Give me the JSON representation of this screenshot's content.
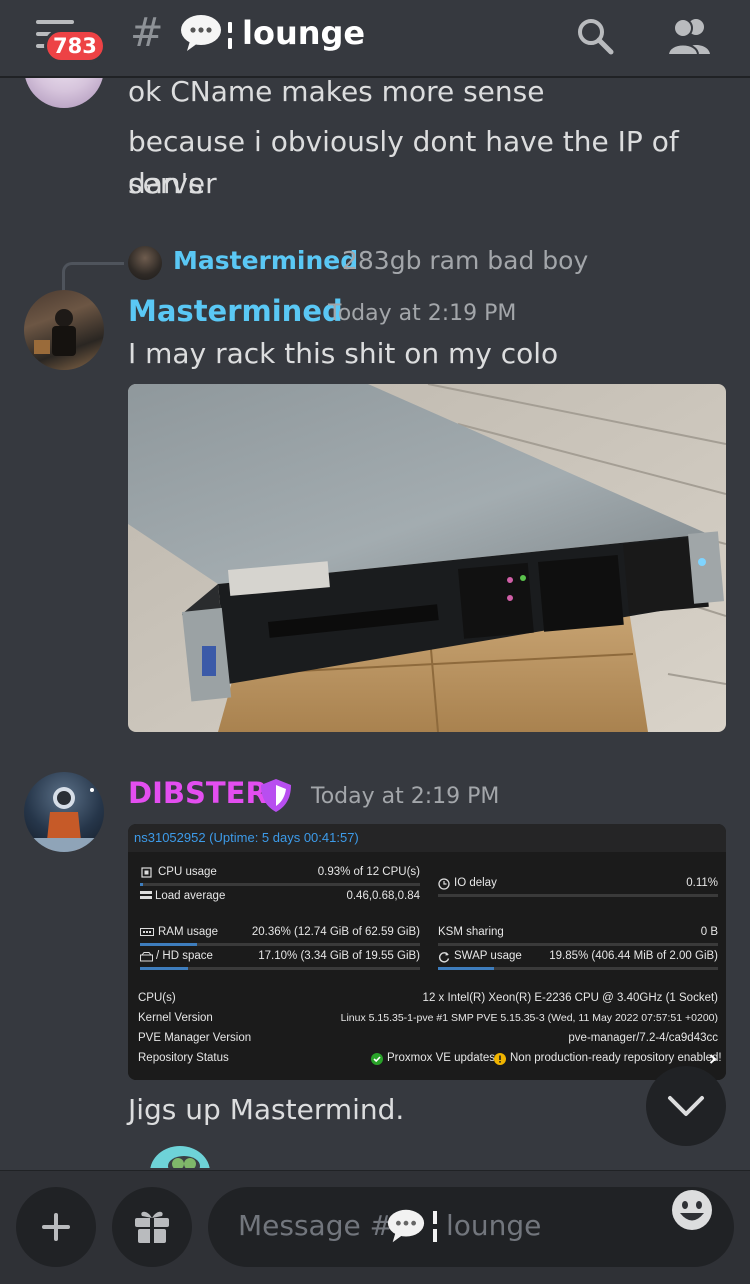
{
  "header": {
    "unread_badge": "783",
    "hash": "#",
    "channel_name": "lounge",
    "channel_emoji": "speech-balloon-icon"
  },
  "messages": {
    "prev_line1": "ok CName makes more sense",
    "prev_line2": "because i obviously dont have the IP of dan's",
    "prev_line3": "server",
    "reply": {
      "author": "Mastermined",
      "text": "283gb ram bad boy"
    },
    "m1": {
      "author": "Mastermined",
      "time": "Today at 2:19 PM",
      "text": "I may rack this shit on my colo"
    },
    "m2": {
      "author": "DIBSTER",
      "time": "Today at 2:19 PM",
      "text": "Jigs up Mastermind."
    }
  },
  "proxmox": {
    "title": "ns31052952 (Uptime: 5 days 00:41:57)",
    "cpu_label": "CPU usage",
    "cpu_value": "0.93% of 12 CPU(s)",
    "cpu_fraction": 0.0093,
    "io_label": "IO delay",
    "io_value": "0.11%",
    "load_label": "Load average",
    "load_value": "0.46,0.68,0.84",
    "ram_label": "RAM usage",
    "ram_value": "20.36% (12.74 GiB of 62.59 GiB)",
    "ram_fraction": 0.2036,
    "ksm_label": "KSM sharing",
    "ksm_value": "0 B",
    "hd_label": "/ HD space",
    "hd_value": "17.10% (3.34 GiB of 19.55 GiB)",
    "hd_fraction": 0.171,
    "swap_label": "SWAP usage",
    "swap_value": "19.85% (406.44 MiB of 2.00 GiB)",
    "swap_fraction": 0.1985,
    "cpus_label": "CPU(s)",
    "cpus_value": "12 x Intel(R) Xeon(R) E-2236 CPU @ 3.40GHz (1 Socket)",
    "kernel_label": "Kernel Version",
    "kernel_value": "Linux 5.15.35-1-pve #1 SMP PVE 5.15.35-3 (Wed, 11 May 2022 07:57:51 +0200)",
    "pve_label": "PVE Manager Version",
    "pve_value": "pve-manager/7.2-4/ca9d43cc",
    "repo_label": "Repository Status",
    "repo_ok": "Proxmox VE updates",
    "repo_warn": "Non production-ready repository enabled!"
  },
  "composer": {
    "placeholder_prefix": "Message #",
    "placeholder_channel": "lounge"
  },
  "colors": {
    "background": "#36393f",
    "mastermined": "#5ac8f5",
    "dibster": "#e34ef0",
    "badge": "#ed4245"
  }
}
